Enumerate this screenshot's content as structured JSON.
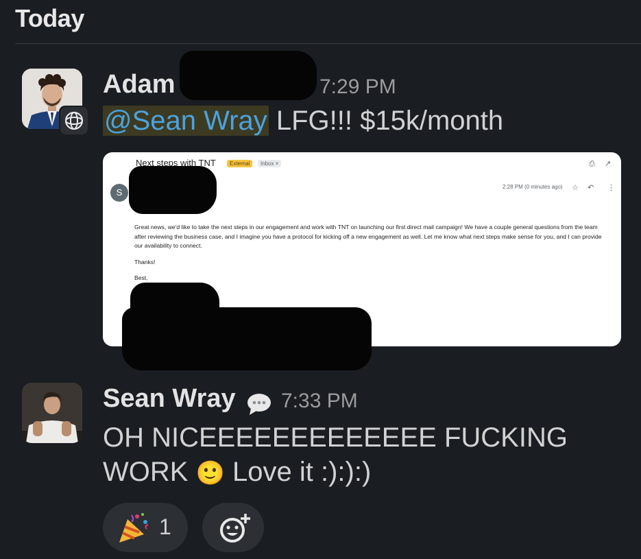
{
  "day_header": "Today",
  "messages": [
    {
      "author": "Adam",
      "time": "7:29 PM",
      "mention": "@Sean Wray",
      "text": " LFG!!! $15k/month",
      "attachment": {
        "subject": "Next steps with TNT",
        "tag_external": "External",
        "tag_inbox": "Inbox ×",
        "sender_initial": "S",
        "timestamp": "2:28 PM (0 minutes ago)",
        "body_paragraphs": [
          "Great news, we'd like to take the next steps in our engagement and work with TNT on launching our first direct mail campaign! We have a couple general questions from the team after reviewing the business case, and I imagine you have a protocol for kicking off a new engagement as well. Let me know what next steps make sense for you, and I can provide our availability to connect.",
          "Thanks!",
          "Best,"
        ]
      }
    },
    {
      "author": "Sean Wray",
      "time": "7:33 PM",
      "line1": "OH NICEEEEEEEEEEEEE FUCKING",
      "line2_text": "WORK",
      "line2_emoji": "🙂",
      "line2_rest": "Love it :):):)"
    }
  ],
  "reactions": [
    {
      "emoji": "party-popper",
      "count": "1"
    }
  ],
  "add_reaction_icon": "add-emoji-icon",
  "colors": {
    "background": "#1a1d21",
    "mention": "#4aa3e0",
    "mention_bg": "#3d3a22"
  }
}
